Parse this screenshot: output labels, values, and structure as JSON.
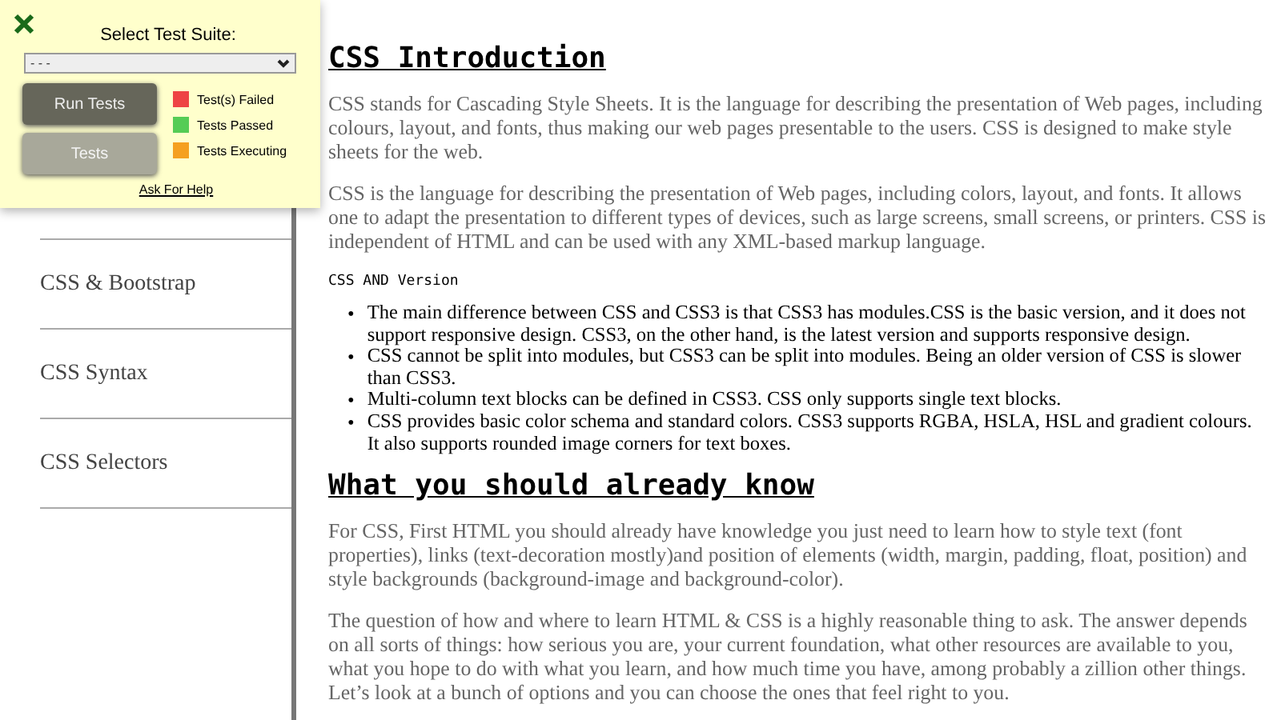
{
  "test_panel": {
    "title": "Select Test Suite:",
    "suite_select": {
      "value": "- - -"
    },
    "buttons": [
      {
        "label": "Run Tests",
        "disabled": false
      },
      {
        "label": "Tests",
        "disabled": true
      }
    ],
    "legend": [
      {
        "label": "Test(s) Failed",
        "color": "#ee4444"
      },
      {
        "label": "Tests Passed",
        "color": "#55cc55"
      },
      {
        "label": "Tests Executing",
        "color": "#f5a020"
      }
    ],
    "help_link": "Ask For Help"
  },
  "sidebar": {
    "items": [
      {
        "label": "CSS & Bootstrap"
      },
      {
        "label": "CSS Syntax"
      },
      {
        "label": "CSS Selectors"
      }
    ]
  },
  "content": [
    {
      "kind": "heading",
      "text": "CSS Introduction"
    },
    {
      "kind": "paragraph",
      "text": "CSS stands for Cascading Style Sheets. It is the language for describing the presentation of Web pages, including colours, layout, and fonts, thus making our web pages presentable to the users. CSS is designed to make style sheets for the web."
    },
    {
      "kind": "paragraph",
      "text": "CSS is the language for describing the presentation of Web pages, including colors, layout, and fonts. It allows one to adapt the presentation to different types of devices, such as large screens, small screens, or printers. CSS is independent of HTML and can be used with any XML-based markup language."
    },
    {
      "kind": "code_label",
      "text": "CSS AND Version"
    },
    {
      "kind": "list",
      "marker": "•",
      "items": [
        "The main difference between CSS and CSS3 is that CSS3 has modules.CSS is the basic version, and it does not support responsive design. CSS3, on the other hand, is the latest version and supports responsive design.",
        "CSS cannot be split into modules, but CSS3 can be split into modules. Being an older version of CSS is slower than CSS3.",
        "Multi-column text blocks can be defined in CSS3. CSS only supports single text blocks.",
        "CSS provides basic color schema and standard colors. CSS3 supports RGBA, HSLA, HSL and gradient colours. It also supports rounded image corners for text boxes."
      ]
    },
    {
      "kind": "heading",
      "text": "What you should already know"
    },
    {
      "kind": "paragraph",
      "text": "For CSS, First HTML you should already have knowledge you just need to learn how to style text (font properties), links (text-decoration mostly)and position of elements (width, margin, padding, float, position) and style backgrounds (background-image and background-color)."
    },
    {
      "kind": "paragraph",
      "text": "The question of how and where to learn HTML & CSS is a highly reasonable thing to ask. The answer depends on all sorts of things: how serious you are, your current foundation, what other resources are available to you, what you hope to do with what you learn, and how much time you have, among probably a zillion other things. Let’s look at a bunch of options and you can choose the ones that feel right to you."
    }
  ]
}
